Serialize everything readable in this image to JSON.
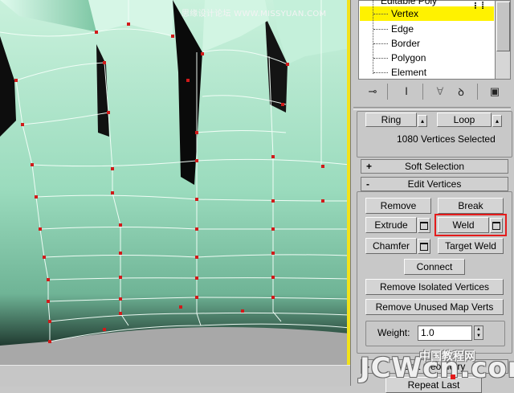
{
  "watermark_top": "思缘设计论坛 WWW.MISSYUAN.COM",
  "watermark_bottom_cn": "中国教程网",
  "watermark_bottom_en": "JCWcn.com",
  "stack": {
    "partial_top_label": "Editable Poly",
    "items": [
      {
        "label": "Vertex",
        "selected": true
      },
      {
        "label": "Edge",
        "selected": false
      },
      {
        "label": "Border",
        "selected": false
      },
      {
        "label": "Polygon",
        "selected": false
      },
      {
        "label": "Element",
        "selected": false
      }
    ],
    "selected_color": "#fff200"
  },
  "toolbar_icons": [
    "pin-stack-icon",
    "show-end-result-icon",
    "make-unique-icon",
    "remove-modifier-icon",
    "configure-modifier-sets-icon"
  ],
  "selection": {
    "ring_label": "Ring",
    "loop_label": "Loop",
    "status": "1080 Vertices Selected"
  },
  "rollouts": {
    "soft_selection": {
      "sign": "+",
      "title": "Soft Selection"
    },
    "edit_vertices": {
      "sign": "-",
      "title": "Edit Vertices"
    },
    "edit_geometry": {
      "sign": "-",
      "title": "Edit Geometry"
    }
  },
  "edit_vertices": {
    "remove": "Remove",
    "break": "Break",
    "extrude": "Extrude",
    "weld": "Weld",
    "chamfer": "Chamfer",
    "target_weld": "Target Weld",
    "connect": "Connect",
    "remove_isolated": "Remove Isolated Vertices",
    "remove_unused_map": "Remove Unused Map Verts",
    "weight_label": "Weight:",
    "weight_value": "1.0"
  },
  "bottom_partial_button": "Repeat Last",
  "colors": {
    "viewport_border": "#f2e21a",
    "mesh_light": "#cdf3df",
    "mesh_mid": "#8fd3b2",
    "mesh_dark": "#2f5f4c",
    "vertex": "#d11a1a",
    "weld_highlight": "#e41b1b"
  }
}
